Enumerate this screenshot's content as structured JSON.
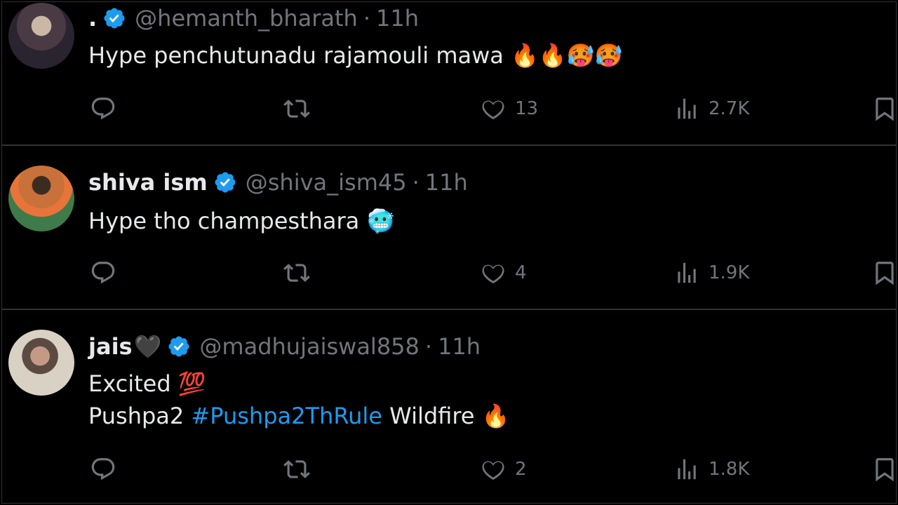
{
  "tweets": [
    {
      "name": ".",
      "handle": "@hemanth_bharath",
      "separator": "·",
      "time": "11h",
      "text": "Hype penchutunadu rajamouli mawa",
      "emojis": "🔥🔥🥵🥵",
      "stats": {
        "replies": "",
        "reposts": "",
        "likes": "13",
        "views": "2.7K"
      }
    },
    {
      "name": "shiva ism",
      "handle": "@shiva_ism45",
      "separator": "·",
      "time": "11h",
      "text": "Hype tho champesthara",
      "emojis": "🥶",
      "stats": {
        "replies": "",
        "reposts": "",
        "likes": "4",
        "views": "1.9K"
      }
    },
    {
      "name": "jais",
      "name_emoji": "🖤",
      "handle": "@madhujaiswal858",
      "separator": "·",
      "time": "11h",
      "line1": "Excited",
      "line1_emoji": "💯",
      "line2_prefix": "Pushpa2",
      "line2_hashtag": "#Pushpa2ThRule",
      "line2_suffix": "Wildfire",
      "line2_emoji": "🔥",
      "stats": {
        "replies": "",
        "reposts": "",
        "likes": "2",
        "views": "1.8K"
      }
    }
  ],
  "colors": {
    "background": "#000000",
    "text": "#e7e9ea",
    "muted": "#71767b",
    "accent": "#1d9bf0",
    "divider": "#2f3336"
  },
  "icons": [
    "reply-icon",
    "repost-icon",
    "like-icon",
    "views-icon",
    "bookmark-icon",
    "verified-badge-icon"
  ]
}
